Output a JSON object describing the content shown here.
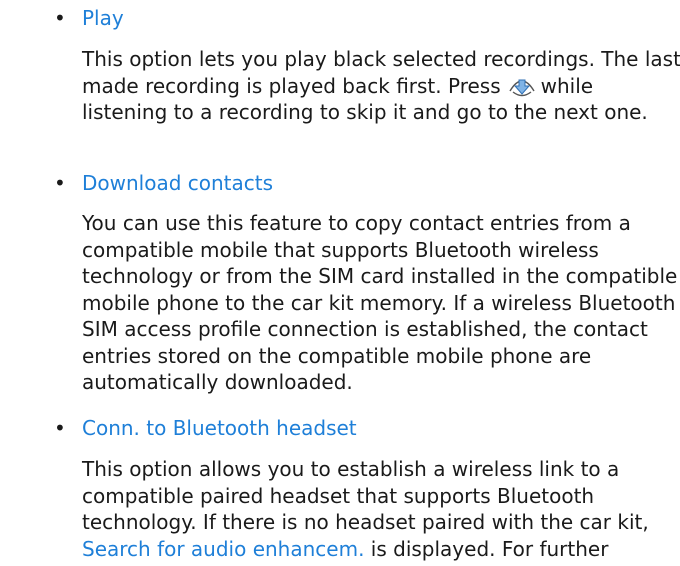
{
  "items": [
    {
      "title": "Play",
      "lines": [
        "This option lets you play black selected recordings. The last",
        "made recording is played back first. Press",
        "while",
        "listening to a recording to skip it and go to the next one."
      ],
      "icon": "navigation-key-down-icon"
    },
    {
      "title": "Download contacts",
      "lines": [
        "You can use this feature to copy contact entries from a",
        "compatible mobile that supports Bluetooth wireless",
        "technology or from the SIM card installed in the compatible",
        "mobile phone to the car kit memory. If a wireless Bluetooth",
        "SIM access profile connection is established, the contact",
        "entries stored on the compatible mobile phone are",
        "automatically downloaded."
      ]
    },
    {
      "title": "Conn. to Bluetooth headset",
      "lines": [
        "This option allows you to establish a wireless link to a",
        "compatible paired headset that supports Bluetooth",
        "technology. If there is no headset paired with the car kit,",
        "Search for audio enhancem.",
        "is displayed. For further"
      ]
    }
  ],
  "colors": {
    "link": "#1e7fd8",
    "text": "#1a1a1a"
  }
}
